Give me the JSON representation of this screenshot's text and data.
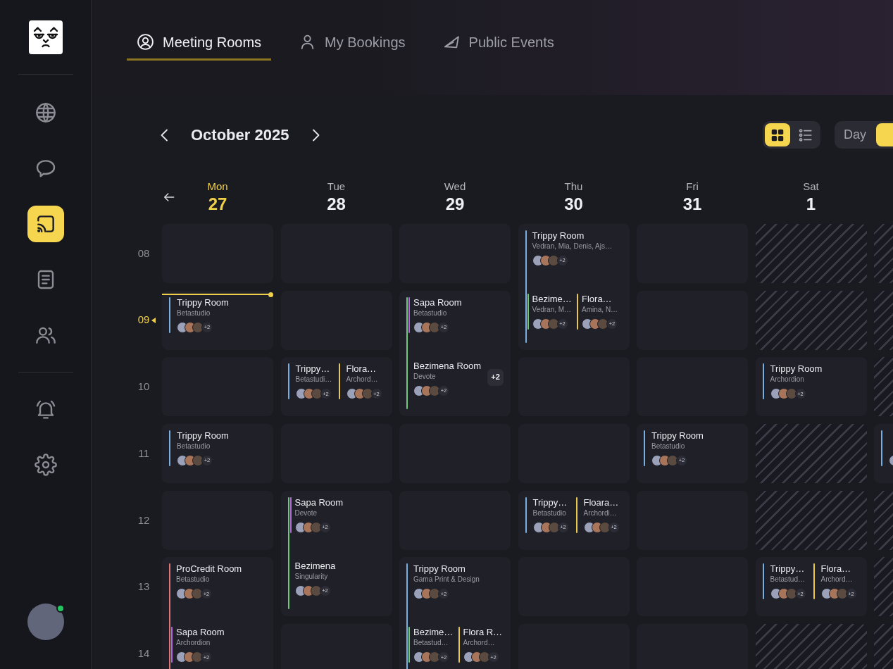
{
  "sidebar": {
    "groups": [
      {
        "items": [
          {
            "selected": false
          },
          {
            "selected": false
          },
          {
            "selected": true
          },
          {
            "selected": false
          },
          {
            "selected": false
          }
        ]
      },
      {
        "items": [
          {
            "selected": false
          },
          {
            "selected": false
          }
        ]
      }
    ],
    "user": {
      "online": true
    }
  },
  "tabs": [
    {
      "label": "Meeting Rooms",
      "selected": true
    },
    {
      "label": "My Bookings",
      "selected": false
    },
    {
      "label": "Public Events",
      "selected": false
    }
  ],
  "toolbar": {
    "month": "October 2025",
    "layouts": [
      {
        "selected": true
      },
      {
        "selected": false
      }
    ],
    "view_modes": [
      {
        "label": "Day",
        "selected": false
      },
      {
        "selected": true
      }
    ]
  },
  "calendar": {
    "hours": [
      {
        "label": "08",
        "current": false
      },
      {
        "label": "09",
        "current": true
      },
      {
        "label": "10",
        "current": false
      },
      {
        "label": "11",
        "current": false
      },
      {
        "label": "12",
        "current": false
      },
      {
        "label": "13",
        "current": false
      },
      {
        "label": "14",
        "current": false
      }
    ],
    "columns": [
      {
        "weekday": "Mon",
        "date": "27",
        "today": true,
        "weekend": false,
        "cells": [
          {
            "kind": "single"
          },
          {
            "kind": "single",
            "events": [
              {
                "title": "Trippy Room",
                "subtitle": "Betastudio",
                "color": "#79aedf",
                "extra": "+2"
              }
            ]
          },
          {
            "kind": "single"
          },
          {
            "kind": "single",
            "events": [
              {
                "title": "Trippy Room",
                "subtitle": "Betastudio",
                "color": "#79aedf",
                "extra": "+2"
              }
            ]
          },
          {
            "kind": "single"
          },
          {
            "kind": "double",
            "slots": [
              {
                "events": [
                  {
                    "title": "ProCredit Room",
                    "subtitle": "Betastudio",
                    "color": "#e07373",
                    "spans": true,
                    "extra": "+2"
                  }
                ]
              },
              {
                "events": [
                  {
                    "title": "Sapa Room",
                    "subtitle": "Archordion",
                    "color": "#b066d6",
                    "spans": false,
                    "extra": "+2"
                  }
                ]
              }
            ]
          }
        ]
      },
      {
        "weekday": "Tue",
        "date": "28",
        "today": false,
        "weekend": false,
        "cells": [
          {
            "kind": "single"
          },
          {
            "kind": "single"
          },
          {
            "kind": "single",
            "events": [
              {
                "title": "Trippy…",
                "subtitle": "Betastudi…",
                "color": "#79aedf",
                "extra": "+2"
              },
              {
                "title": "Flora…",
                "subtitle": "Archord…",
                "color": "#e9c948",
                "extra": "+2"
              }
            ]
          },
          {
            "kind": "single"
          },
          {
            "kind": "double",
            "slots": [
              {
                "events": [
                  {
                    "title": "Sapa Room",
                    "subtitle": "Devote",
                    "color": "#b066d6",
                    "spans": false,
                    "extra": "+2"
                  }
                ]
              },
              {
                "events": [
                  {
                    "title": "Bezimena",
                    "subtitle": "Singularity",
                    "color": "#71c77c",
                    "spans": true,
                    "extra": "+2"
                  }
                ]
              }
            ]
          },
          {
            "kind": "single"
          }
        ]
      },
      {
        "weekday": "Wed",
        "date": "29",
        "today": false,
        "weekend": false,
        "cells": [
          {
            "kind": "single"
          },
          {
            "kind": "double",
            "slots": [
              {
                "events": [
                  {
                    "title": "Sapa Room",
                    "subtitle": "Betastudio",
                    "color": "#b066d6",
                    "spans": false,
                    "extra": "+2"
                  }
                ]
              },
              {
                "events": [
                  {
                    "title": "Bezimena Room",
                    "subtitle": "Devote",
                    "color": "#71c77c",
                    "spans": true,
                    "extra": "+2",
                    "badge": "+2"
                  }
                ]
              }
            ]
          },
          {
            "kind": "single"
          },
          {
            "kind": "single"
          },
          {
            "kind": "double",
            "slots": [
              {
                "events": [
                  {
                    "title": "Trippy Room",
                    "subtitle": "Gama Print & Design",
                    "color": "#79aedf",
                    "spans": true,
                    "extra": "+2"
                  }
                ]
              },
              {
                "events": [
                  {
                    "title": "Bezime…",
                    "subtitle": "Betastud…",
                    "color": "#71c77c",
                    "spans": false,
                    "extra": "+2"
                  },
                  {
                    "title": "Flora R…",
                    "subtitle": "Archord…",
                    "color": "#e9c948",
                    "spans": false,
                    "extra": "+2"
                  }
                ]
              }
            ]
          }
        ]
      },
      {
        "weekday": "Thu",
        "date": "30",
        "today": false,
        "weekend": false,
        "cells": [
          {
            "kind": "double",
            "slots": [
              {
                "events": [
                  {
                    "title": "Trippy Room",
                    "subtitle": "Vedran, Mia, Denis, Ajs…",
                    "color": "#79aedf",
                    "spans": true,
                    "extra": "+2"
                  }
                ]
              },
              {
                "events": [
                  {
                    "title": "Bezime…",
                    "subtitle": "Vedran, M…",
                    "color": "#71c77c",
                    "spans": false,
                    "extra": "+2"
                  },
                  {
                    "title": "Flora…",
                    "subtitle": "Amina, N…",
                    "color": "#e9c948",
                    "spans": false,
                    "extra": "+2"
                  }
                ]
              }
            ]
          },
          {
            "kind": "single"
          },
          {
            "kind": "single"
          },
          {
            "kind": "single",
            "events": [
              {
                "title": "Trippy…",
                "subtitle": "Betastudio",
                "color": "#79aedf",
                "extra": "+2"
              },
              {
                "title": "Floara…",
                "subtitle": "Archordi…",
                "color": "#e9c948",
                "extra": "+2"
              }
            ]
          },
          {
            "kind": "single"
          },
          {
            "kind": "single"
          }
        ]
      },
      {
        "weekday": "Fri",
        "date": "31",
        "today": false,
        "weekend": false,
        "cells": [
          {
            "kind": "single"
          },
          {
            "kind": "single"
          },
          {
            "kind": "single"
          },
          {
            "kind": "single",
            "events": [
              {
                "title": "Trippy Room",
                "subtitle": "Betastudio",
                "color": "#79aedf",
                "extra": "+2"
              }
            ]
          },
          {
            "kind": "single"
          },
          {
            "kind": "single"
          },
          {
            "kind": "single"
          }
        ]
      },
      {
        "weekday": "Sat",
        "date": "1",
        "today": false,
        "weekend": true,
        "cells": [
          {
            "kind": "single"
          },
          {
            "kind": "single"
          },
          {
            "kind": "single",
            "events": [
              {
                "title": "Trippy Room",
                "subtitle": "Archordion",
                "color": "#79aedf",
                "extra": "+2"
              }
            ]
          },
          {
            "kind": "single"
          },
          {
            "kind": "single"
          },
          {
            "kind": "single",
            "events": [
              {
                "title": "Trippy…",
                "subtitle": "Betastud…",
                "color": "#79aedf",
                "extra": "+2"
              },
              {
                "title": "Flora…",
                "subtitle": "Archord…",
                "color": "#e9c948",
                "extra": "+2"
              }
            ]
          },
          {
            "kind": "single"
          }
        ]
      },
      {
        "today": false,
        "weekend": true,
        "cells": [
          {
            "kind": "single"
          },
          {
            "kind": "single"
          },
          {
            "kind": "single"
          },
          {
            "kind": "single",
            "events": [
              {
                "color": "#79aedf"
              }
            ]
          },
          {
            "kind": "single"
          },
          {
            "kind": "single"
          },
          {
            "kind": "single"
          }
        ]
      }
    ]
  }
}
